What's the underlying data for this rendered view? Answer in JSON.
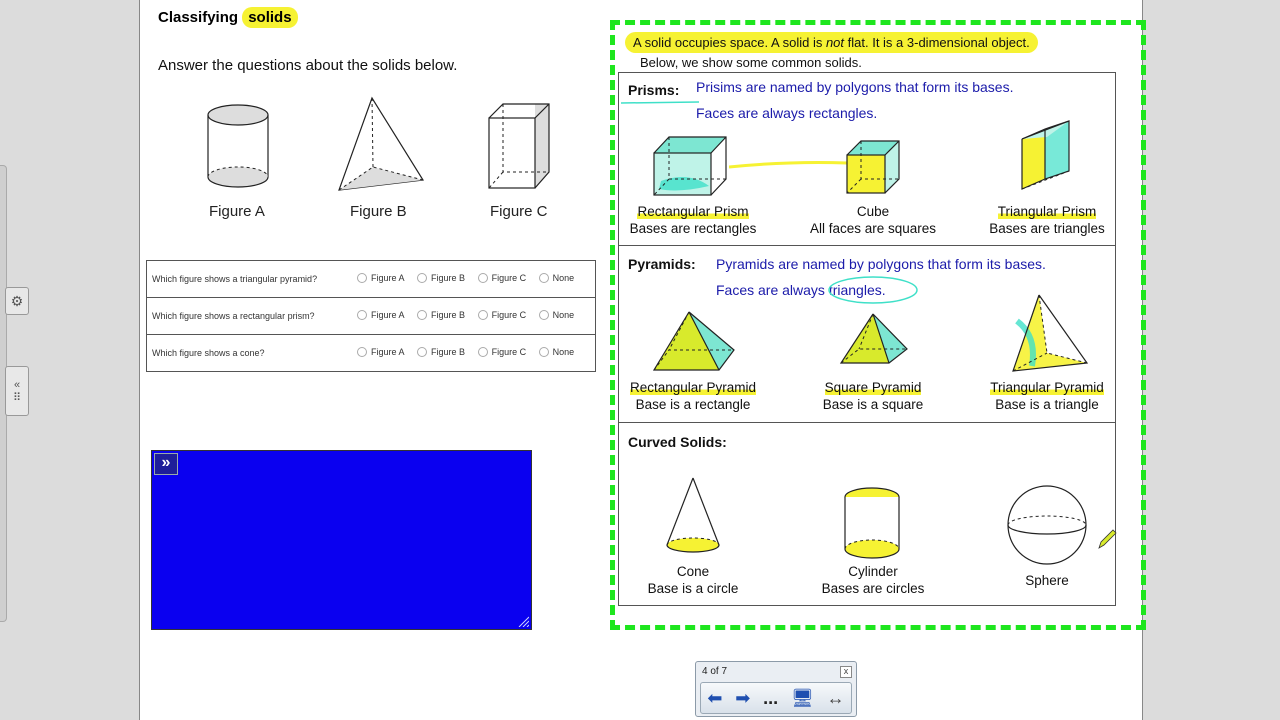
{
  "sidebar_icons": {
    "settings": "gear-icon",
    "collapse": "double-chevron-left-icon",
    "keypad": "keypad-icon"
  },
  "header": {
    "title_prefix": "Classifying ",
    "title_highlight": "solids"
  },
  "instructions": "Answer the questions about the solids below.",
  "figures": [
    {
      "label": "Figure A"
    },
    {
      "label": "Figure B"
    },
    {
      "label": "Figure C"
    }
  ],
  "questions": [
    {
      "text": "Which figure shows a triangular pyramid?",
      "options": [
        "Figure A",
        "Figure B",
        "Figure C",
        "None"
      ]
    },
    {
      "text": "Which figure shows a rectangular prism?",
      "options": [
        "Figure A",
        "Figure B",
        "Figure C",
        "None"
      ]
    },
    {
      "text": "Which figure shows a cone?",
      "options": [
        "Figure A",
        "Figure B",
        "Figure C",
        "None"
      ]
    }
  ],
  "note": {
    "line1_a": "A solid occupies space. A solid is ",
    "line1_em": "not",
    "line1_b": " flat. It is a 3-dimensional object.",
    "line2": "Below, we show some common solids."
  },
  "prisms": {
    "title": "Prisms:",
    "line1": "Prisims are named by polygons that form its bases.",
    "line2": "Faces are always rectangles.",
    "items": [
      {
        "name": "Rectangular Prism",
        "desc": "Bases are rectangles"
      },
      {
        "name": "Cube",
        "desc": "All faces are squares"
      },
      {
        "name": "Triangular Prism",
        "desc": "Bases are triangles"
      }
    ]
  },
  "pyramids": {
    "title": "Pyramids:",
    "line1": "Pyramids are named by polygons that form its bases.",
    "line2": "Faces are always triangles.",
    "items": [
      {
        "name": "Rectangular Pyramid",
        "desc": "Base is a rectangle"
      },
      {
        "name": "Square Pyramid",
        "desc": "Base is a square"
      },
      {
        "name": "Triangular Pyramid",
        "desc": "Base is a triangle"
      }
    ]
  },
  "curved": {
    "title": "Curved Solids:",
    "items": [
      {
        "name": "Cone",
        "desc": "Base is a circle"
      },
      {
        "name": "Cylinder",
        "desc": "Bases are circles"
      },
      {
        "name": "Sphere",
        "desc": ""
      }
    ]
  },
  "nav": {
    "page_count": "4 of 7",
    "close": "x",
    "more": "..."
  },
  "colors": {
    "highlight": "#f6f233",
    "dash_border": "#1ee61e",
    "blue_box": "#0a00f0",
    "panel_text": "#1b1baa",
    "cyan_ink": "#3fe0c8"
  }
}
